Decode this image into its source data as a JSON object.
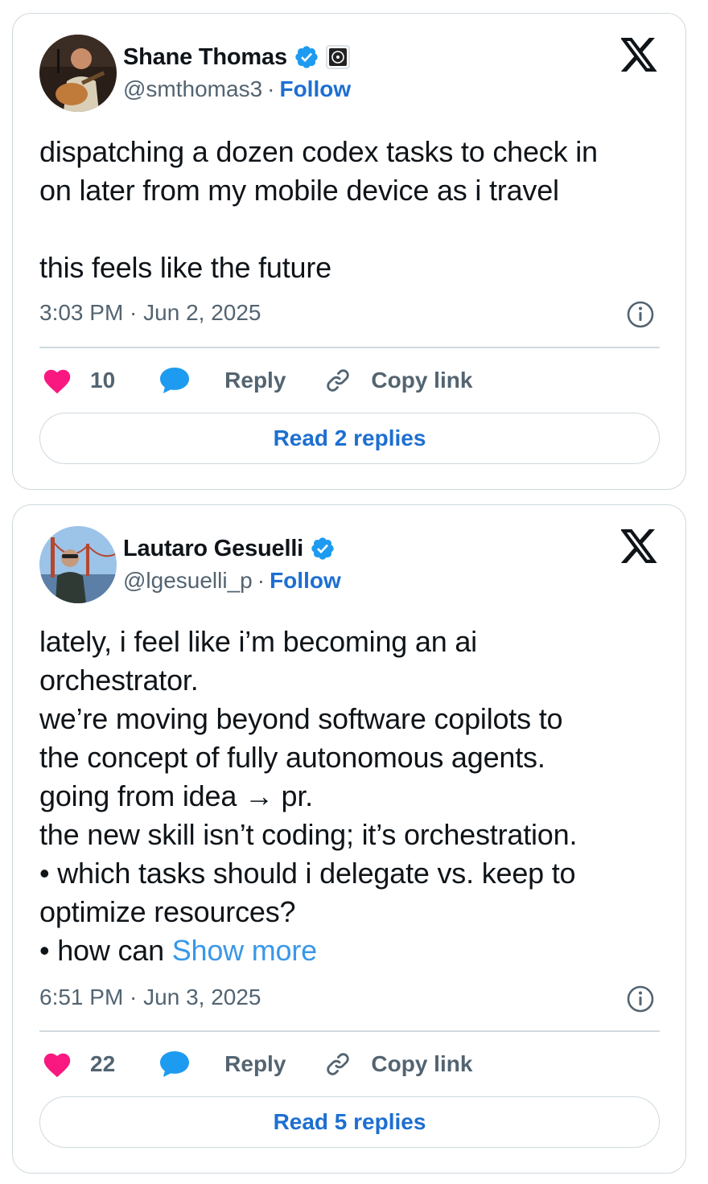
{
  "tweets": [
    {
      "author": "Shane Thomas",
      "handle": "@smthomas3",
      "separator": "·",
      "follow_label": "Follow",
      "text_lines": [
        "dispatching a dozen codex tasks to check in",
        "on later from my mobile device as i travel",
        "",
        "this feels like the future"
      ],
      "timestamp": "3:03 PM · Jun 2, 2025",
      "like_count": "10",
      "reply_label": "Reply",
      "copy_link_label": "Copy link",
      "read_replies_label": "Read 2 replies"
    },
    {
      "author": "Lautaro Gesuelli",
      "handle": "@lgesuelli_p",
      "separator": "·",
      "follow_label": "Follow",
      "text_lines": [
        "lately, i feel like i’m becoming an ai",
        "orchestrator.",
        "we’re moving beyond software copilots to",
        "the concept of fully autonomous agents.",
        "going from idea → pr.",
        "the new skill isn’t coding; it’s orchestration.",
        "• which tasks should i delegate vs. keep to",
        "optimize resources?",
        "• how can "
      ],
      "show_more_label": "Show more",
      "timestamp": "6:51 PM · Jun 3, 2025",
      "like_count": "22",
      "reply_label": "Reply",
      "copy_link_label": "Copy link",
      "read_replies_label": "Read 5 replies"
    }
  ],
  "icons": {
    "verified": "verified-badge-icon",
    "affiliate": "affiliate-badge-icon",
    "brand": "x-logo-icon",
    "info": "info-icon",
    "like": "heart-icon",
    "reply": "reply-bubble-icon",
    "copy": "link-icon"
  },
  "colors": {
    "follow": "#1d6fd1",
    "verified": "#1d9bf0",
    "like": "#f91880",
    "reply": "#1d9bf0",
    "show_more": "#3a97e8"
  }
}
